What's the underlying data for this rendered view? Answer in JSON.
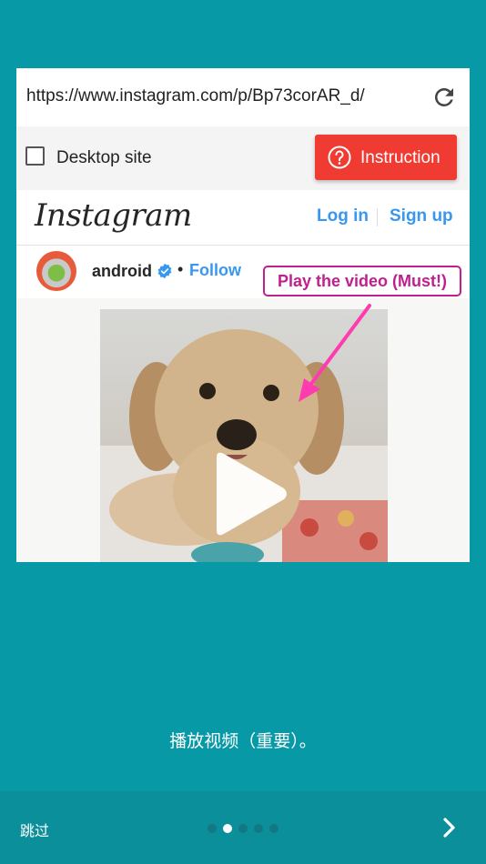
{
  "browser": {
    "url": "https://www.instagram.com/p/Bp73corAR_d/",
    "desktop_site_label": "Desktop site",
    "desktop_site_checked": false,
    "instruction_label": "Instruction",
    "instruction_color": "#ef3b32"
  },
  "instagram": {
    "logo_text": "Instagram",
    "login_label": "Log in",
    "signup_label": "Sign up",
    "link_color": "#3897f0",
    "post": {
      "username": "android",
      "separator": "•",
      "follow_label": "Follow"
    }
  },
  "callout": {
    "text": "Play the video (Must!)",
    "color": "#c0208e"
  },
  "caption": "播放视频（重要）。",
  "footer": {
    "skip_label": "跳过",
    "page_count": 5,
    "active_page": 2
  },
  "colors": {
    "background": "#0899a6",
    "footer": "#0b8f9b"
  },
  "icons": {
    "refresh": "refresh-icon",
    "instruction": "question-circle-icon",
    "verified": "verified-badge-icon",
    "play": "play-icon",
    "next": "chevron-right-icon"
  }
}
